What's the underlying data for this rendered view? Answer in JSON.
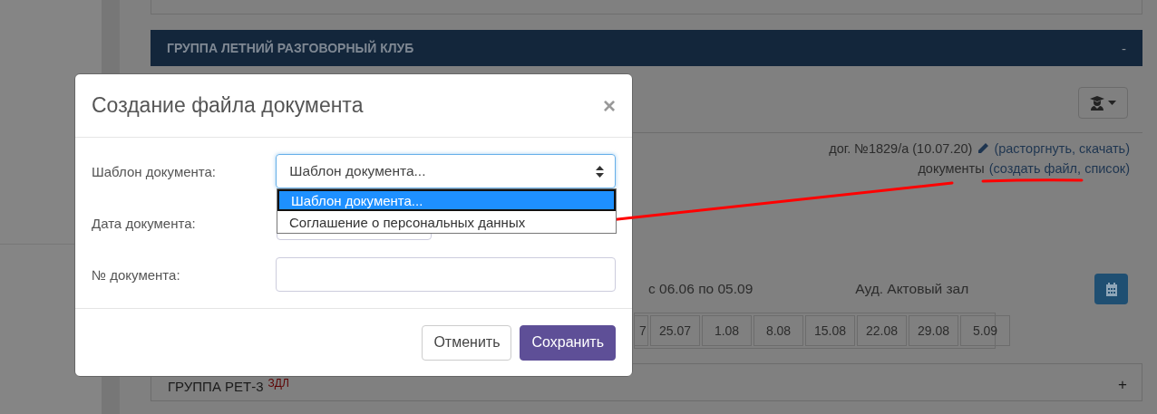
{
  "group_panel": {
    "title": "ГРУППА ЛЕТНИЙ РАЗГОВОРНЫЙ КЛУБ",
    "toggle": "-",
    "contract": {
      "text": "дог. №1829/а (10.07.20)",
      "actions": "(расторгнуть, скачать)"
    },
    "documents": {
      "label": "документы",
      "actions": "(создать файл, список)"
    },
    "schedule": {
      "period": "с 06.06 по 05.09",
      "room": "Ауд. Актовый зал"
    },
    "dates": [
      "7",
      "25.07",
      "1.08",
      "8.08",
      "15.08",
      "22.08",
      "29.08",
      "5.09"
    ]
  },
  "collapsed_group": {
    "title": "ГРУППА РЕТ-3",
    "tag": "ЗДЛ",
    "toggle": "+"
  },
  "modal": {
    "title": "Создание файла документа",
    "close": "×",
    "fields": [
      {
        "kind": "select",
        "label": "Шаблон документа:",
        "value": "Шаблон документа...",
        "expanded": true,
        "options": [
          {
            "label": "Шаблон документа...",
            "selected": true
          },
          {
            "label": "Соглашение о персональных данных",
            "selected": false
          }
        ]
      },
      {
        "kind": "date",
        "label": "Дата документа:"
      },
      {
        "kind": "input",
        "label": "№ документа:"
      }
    ],
    "buttons": [
      {
        "label": "Отменить",
        "kind": "secondary"
      },
      {
        "label": "Сохранить",
        "kind": "primary"
      }
    ]
  }
}
